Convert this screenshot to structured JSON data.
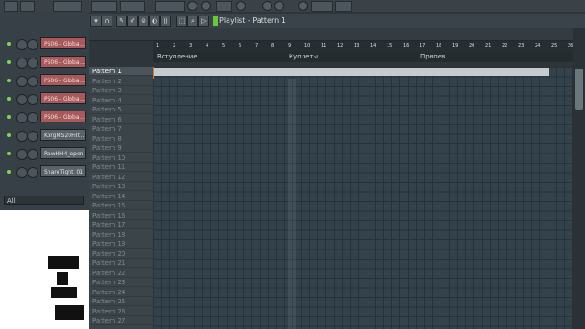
{
  "playlist": {
    "title": "Playlist - Pattern 1"
  },
  "channels": [
    {
      "name": "PS06 - Global...",
      "color": "#a85a5a"
    },
    {
      "name": "PS06 - Global...",
      "color": "#a85a5a"
    },
    {
      "name": "PS06 - Global...",
      "color": "#a85a5a"
    },
    {
      "name": "PS06 - Global...",
      "color": "#a85a5a"
    },
    {
      "name": "PS06 - Global...",
      "color": "#a85a5a"
    },
    {
      "name": "KorgMS20Filt...",
      "color": "#5b6368"
    },
    {
      "name": "RawHH4_open",
      "color": "#5b6368"
    },
    {
      "name": "SnareTight_01",
      "color": "#5b6368"
    }
  ],
  "rack_filter": "All",
  "ruler": [
    "1",
    "2",
    "3",
    "4",
    "5",
    "6",
    "7",
    "8",
    "9",
    "10",
    "11",
    "12",
    "13",
    "14",
    "15",
    "16",
    "17",
    "18",
    "19",
    "20",
    "21",
    "22",
    "23",
    "24",
    "25",
    "26"
  ],
  "markers": [
    "Вступление",
    "Куплеты",
    "Припев"
  ],
  "patterns": [
    "Pattern 1",
    "Pattern 2",
    "Pattern 3",
    "Pattern 4",
    "Pattern 5",
    "Pattern 6",
    "Pattern 7",
    "Pattern 8",
    "Pattern 9",
    "Pattern 10",
    "Pattern 11",
    "Pattern 12",
    "Pattern 13",
    "Pattern 14",
    "Pattern 15",
    "Pattern 16",
    "Pattern 17",
    "Pattern 18",
    "Pattern 19",
    "Pattern 20",
    "Pattern 21",
    "Pattern 22",
    "Pattern 23",
    "Pattern 24",
    "Pattern 25",
    "Pattern 26",
    "Pattern 27"
  ],
  "icons": [
    "menu-icon",
    "magnet-icon",
    "pencil-icon",
    "brush-icon",
    "delete-icon",
    "mute-icon",
    "slice-icon",
    "select-icon",
    "zoom-icon",
    "play-icon"
  ],
  "colors": {
    "accent": "#67c93a",
    "cursor": "#d07a2a",
    "channel_red": "#a85a5a"
  }
}
